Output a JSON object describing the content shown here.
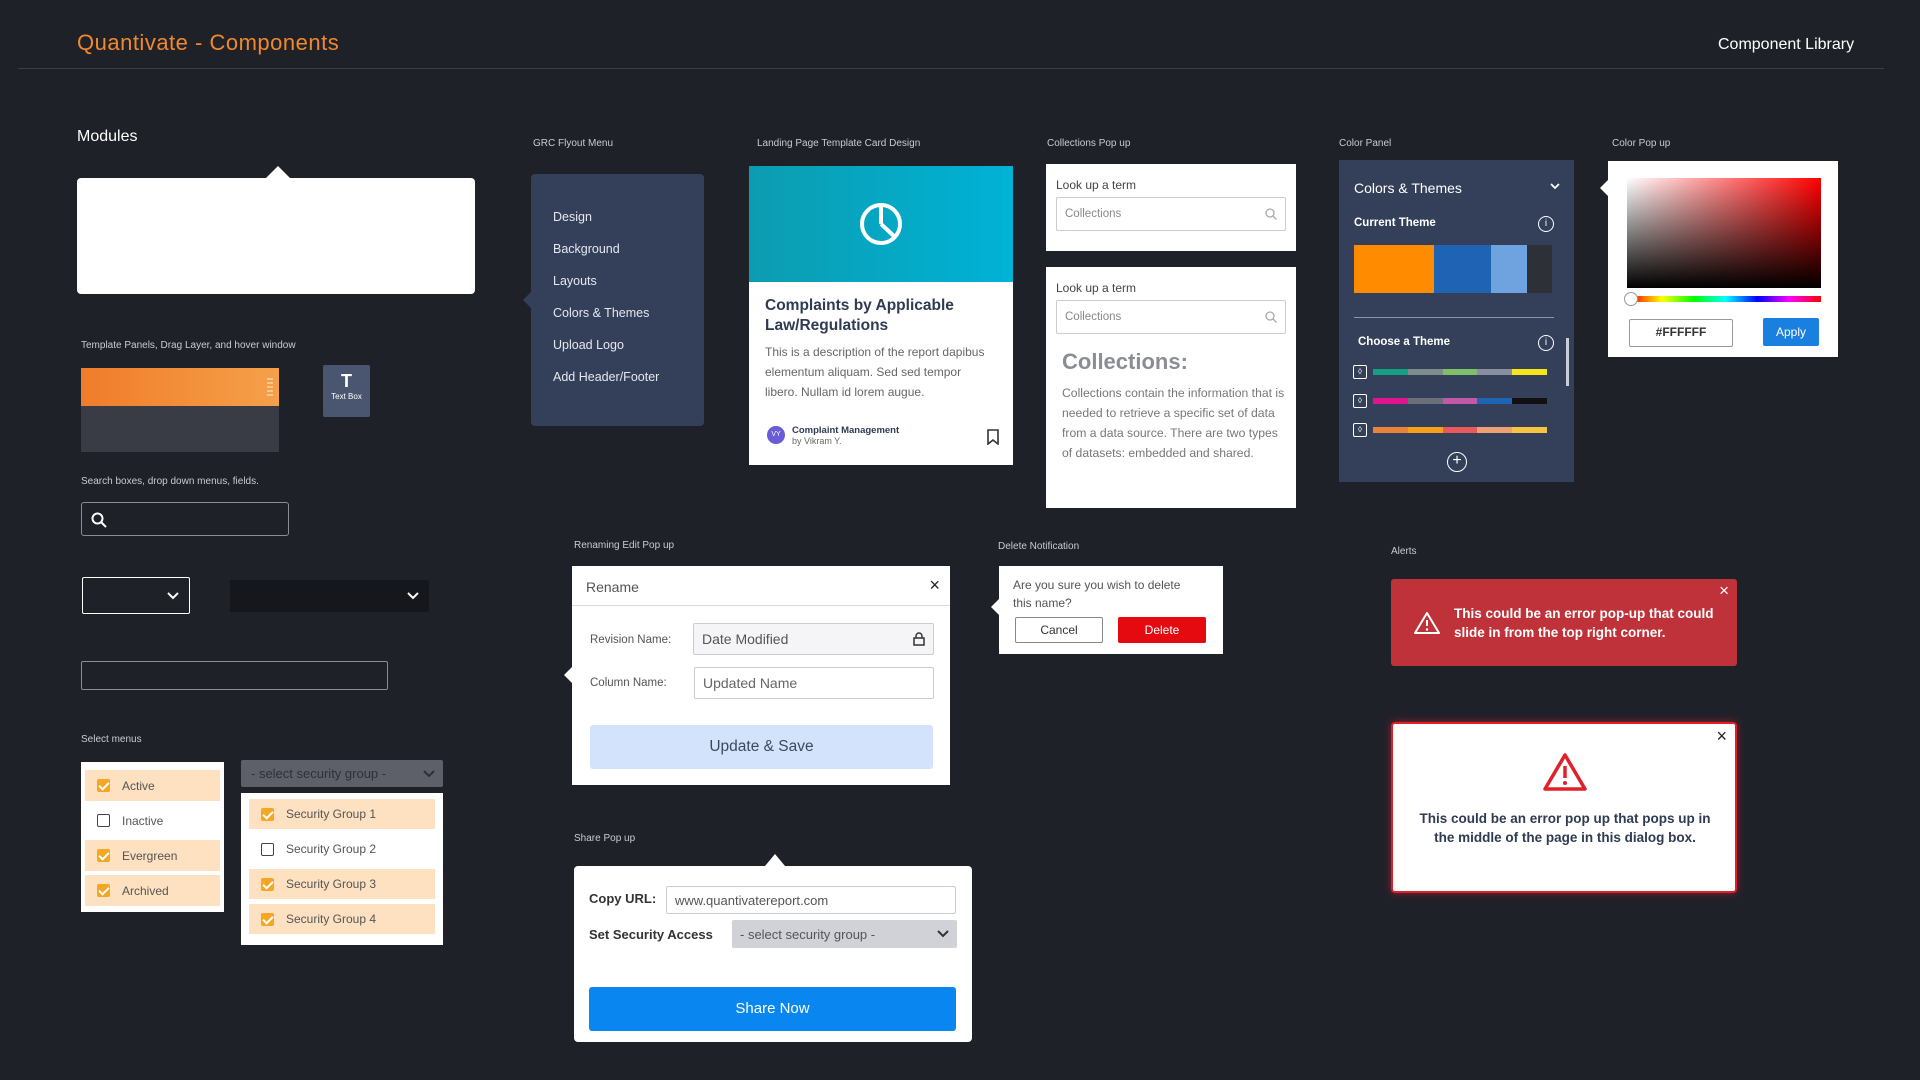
{
  "header": {
    "title": "Quantivate - Components",
    "right_label": "Component Library"
  },
  "modules": {
    "title": "Modules"
  },
  "template_panels": {
    "label": "Template Panels, Drag Layer, and hover window",
    "textbox_label": "Text Box"
  },
  "search": {
    "label": "Search boxes, drop down menus, fields."
  },
  "select_menus": {
    "label": "Select menus",
    "statuses": [
      {
        "label": "Active",
        "checked": true
      },
      {
        "label": "Inactive",
        "checked": false
      },
      {
        "label": "Evergreen",
        "checked": true
      },
      {
        "label": "Archived",
        "checked": true
      }
    ],
    "group_placeholder": "- select security group -",
    "groups": [
      {
        "label": "Security Group 1",
        "checked": true
      },
      {
        "label": "Security Group 2",
        "checked": false
      },
      {
        "label": "Security Group 3",
        "checked": true
      },
      {
        "label": "Security Group 4",
        "checked": true
      }
    ]
  },
  "grc_flyout": {
    "label": "GRC Flyout Menu",
    "items": [
      "Design",
      "Background",
      "Layouts",
      "Colors & Themes",
      "Upload Logo",
      "Add Header/Footer"
    ]
  },
  "landing_card": {
    "label": "Landing Page Template Card Design",
    "title": "Complaints by Applicable Law/Regulations",
    "description": "This is a description of the report dapibus elementum aliquam. Sed sed tempor libero. Nullam id lorem augue.",
    "avatar_initials": "VY",
    "category": "Complaint Management",
    "author": "by Vikram Y."
  },
  "collections": {
    "label": "Collections Pop up",
    "lookup_label": "Look up a term",
    "placeholder": "Collections",
    "heading": "Collections:",
    "body": "Collections contain the information that is needed to retrieve a specific set of data from a data source. There are two types of datasets: embedded and shared."
  },
  "color_panel": {
    "label": "Color Panel",
    "title": "Colors & Themes",
    "current_theme": "Current Theme",
    "choose_theme": "Choose a Theme",
    "current_colors": [
      "#ff8c00",
      "#1e63b4",
      "#6fa3e0",
      "#2e3038"
    ],
    "themes": [
      [
        "#14a085",
        "#7f8c8d",
        "#7fbf6a",
        "#8a8fa0",
        "#f5e51b"
      ],
      [
        "#e0148c",
        "#6b6f78",
        "#c05aa8",
        "#1e63b4",
        "#111111"
      ],
      [
        "#e8833a",
        "#f5a11a",
        "#e85a5a",
        "#f0a070",
        "#f5c542"
      ]
    ]
  },
  "color_popup": {
    "label": "Color Pop up",
    "hex": "#FFFFFF",
    "apply": "Apply"
  },
  "rename": {
    "label": "Renaming Edit Pop up",
    "title": "Rename",
    "revision_label": "Revision Name:",
    "revision_value": "Date Modified",
    "column_label": "Column Name:",
    "column_placeholder": "Updated Name",
    "button": "Update & Save"
  },
  "delete": {
    "label": "Delete Notification",
    "message": "Are you sure you wish to delete this name?",
    "cancel": "Cancel",
    "confirm": "Delete"
  },
  "share": {
    "label": "Share Pop up",
    "copy_label": "Copy URL:",
    "url": "www.quantivatereport.com",
    "security_label": "Set Security Access",
    "security_placeholder": "- select security group -",
    "button": "Share Now"
  },
  "alerts": {
    "label": "Alerts",
    "toast": "This could be an error pop-up that could slide in from the top right corner.",
    "dialog": "This could be an error pop up that pops up in the middle of the page in this dialog box."
  }
}
